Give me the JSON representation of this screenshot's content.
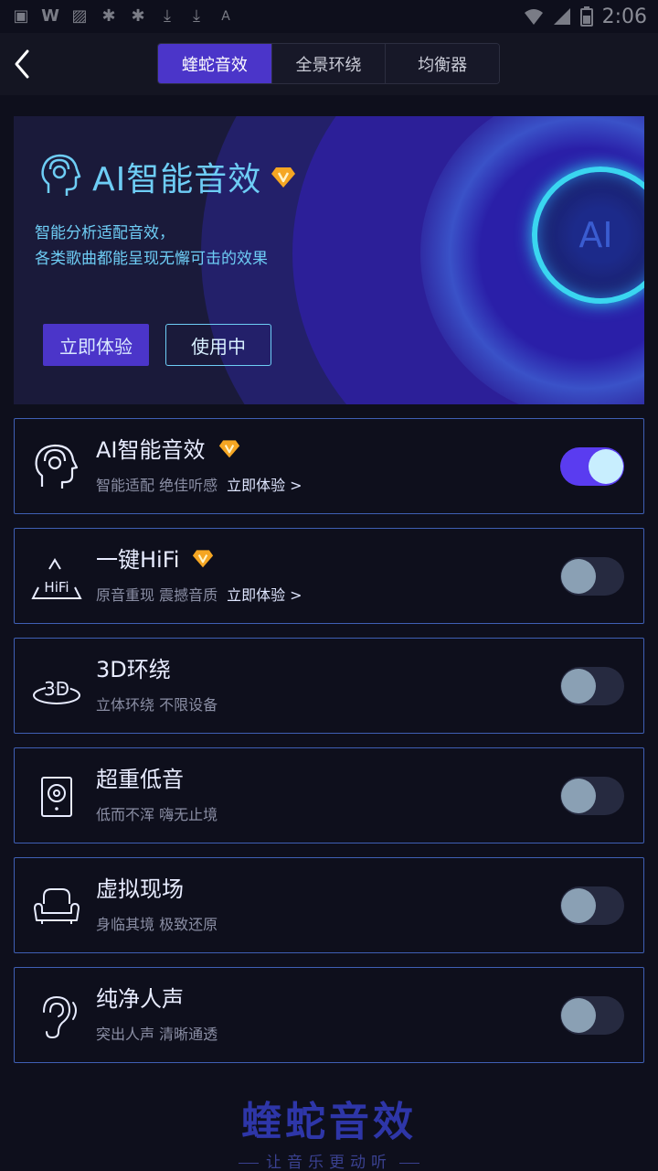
{
  "status_bar": {
    "icons": [
      "app-icon",
      "w-icon",
      "image-icon",
      "bug-icon",
      "bug-icon",
      "download-icon",
      "download-icon",
      "a-icon"
    ],
    "time": "2:06"
  },
  "header": {
    "tabs": [
      {
        "label": "蝰蛇音效",
        "active": true
      },
      {
        "label": "全景环绕",
        "active": false
      },
      {
        "label": "均衡器",
        "active": false
      }
    ]
  },
  "banner": {
    "title": "AI智能音效",
    "desc_line1": "智能分析适配音效，",
    "desc_line2": "各类歌曲都能呈现无懈可击的效果",
    "try_label": "立即体验",
    "use_label": "使用中",
    "orb_label": "AI"
  },
  "items": [
    {
      "title": "AI智能音效",
      "sub": "智能适配 绝佳听感",
      "link": "立即体验 >",
      "vip": true,
      "on": true,
      "icon": "ai-head-icon"
    },
    {
      "title": "一键HiFi",
      "sub": "原音重现 震撼音质",
      "link": "立即体验 >",
      "vip": true,
      "on": false,
      "icon": "hifi-icon"
    },
    {
      "title": "3D环绕",
      "sub": "立体环绕 不限设备",
      "link": "",
      "vip": false,
      "on": false,
      "icon": "3d-surround-icon"
    },
    {
      "title": "超重低音",
      "sub": "低而不浑 嗨无止境",
      "link": "",
      "vip": false,
      "on": false,
      "icon": "speaker-icon"
    },
    {
      "title": "虚拟现场",
      "sub": "身临其境 极致还原",
      "link": "",
      "vip": false,
      "on": false,
      "icon": "sofa-icon"
    },
    {
      "title": "纯净人声",
      "sub": "突出人声 清晰通透",
      "link": "",
      "vip": false,
      "on": false,
      "icon": "ear-icon"
    }
  ],
  "footer": {
    "title": "蝰蛇音效",
    "slogan": "让音乐更动听"
  },
  "colors": {
    "accent": "#4b35c9",
    "toggle_on": "#5a3cf0",
    "cyan": "#6ecdf5",
    "item_border": "#3f5fb4",
    "gem": "#f5a623"
  }
}
